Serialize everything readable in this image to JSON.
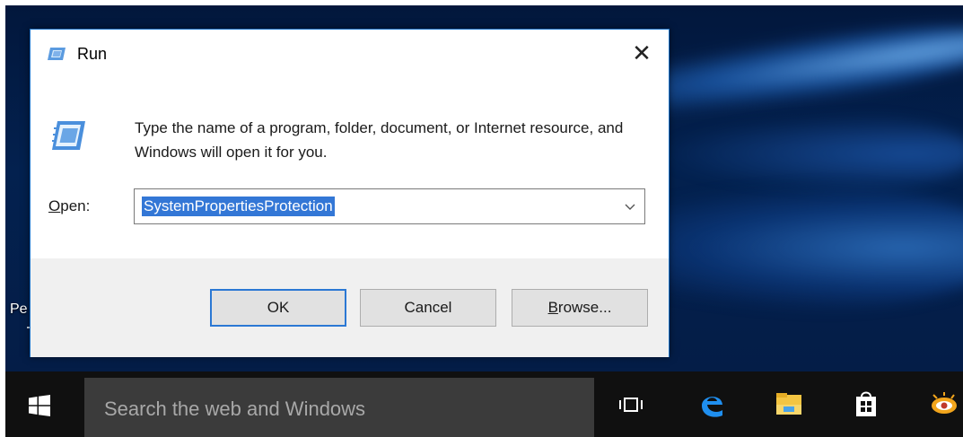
{
  "desktop": {
    "icon_label_partial": "Pe"
  },
  "dialog": {
    "title": "Run",
    "close_glyph": "✕",
    "prompt": "Type the name of a program, folder, document, or Internet resource, and Windows will open it for you.",
    "open_label_mnemonic": "O",
    "open_label_rest": "pen:",
    "open_value": "SystemPropertiesProtection",
    "buttons": {
      "ok": "OK",
      "cancel": "Cancel",
      "browse_mnemonic": "B",
      "browse_rest": "rowse..."
    }
  },
  "taskbar": {
    "search_placeholder": "Search the web and Windows",
    "icons": [
      "windows-start-icon",
      "task-view-icon",
      "edge-browser-icon",
      "file-explorer-icon",
      "store-icon",
      "app-icon"
    ]
  },
  "colors": {
    "accent": "#2b78d4",
    "selection": "#3377d6",
    "taskbar": "#101010",
    "search_box": "#3b3b3b",
    "dialog_footer": "#f0f0f0"
  }
}
